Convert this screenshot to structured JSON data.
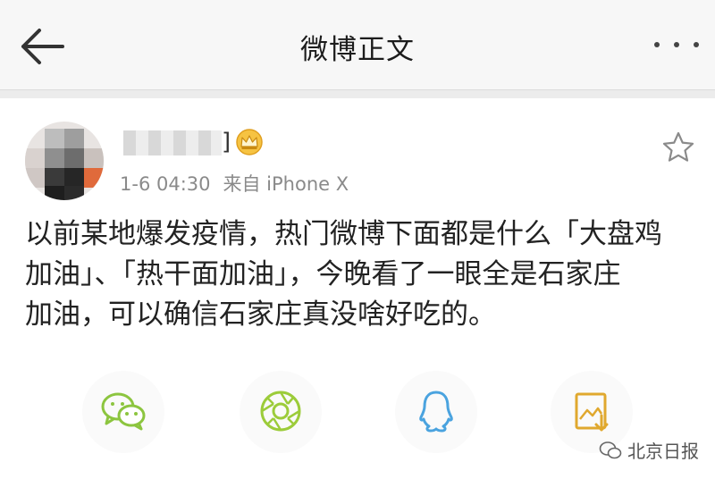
{
  "navbar": {
    "title": "微博正文",
    "back_icon": "arrow-left-icon",
    "more_icon": "more-dots-icon"
  },
  "post": {
    "username_suffix": "]",
    "badge_icon": "crown-icon",
    "time": "1-6 04:30",
    "source": "来自 iPhone X",
    "favorite_icon": "star-icon",
    "text_lines": [
      "以前某地爆发疫情，热门微博下面都是什么「大盘鸡",
      "加油」、「热干面加油」，今晚看了一眼全是石家庄",
      "加油，可以确信石家庄真没啥好吃的。"
    ]
  },
  "share": {
    "items": [
      {
        "icon": "wechat-icon",
        "color": "#8cc53f"
      },
      {
        "icon": "moments-icon",
        "color": "#9ccc3a"
      },
      {
        "icon": "qq-icon",
        "color": "#4aa3df"
      },
      {
        "icon": "save-image-icon",
        "color": "#e0a82e"
      }
    ]
  },
  "watermark": {
    "text": "北京日报"
  },
  "colors": {
    "accent_orange": "#f08a24",
    "meta_gray": "#8a8a8a",
    "nav_bg": "#f7f7f7"
  }
}
